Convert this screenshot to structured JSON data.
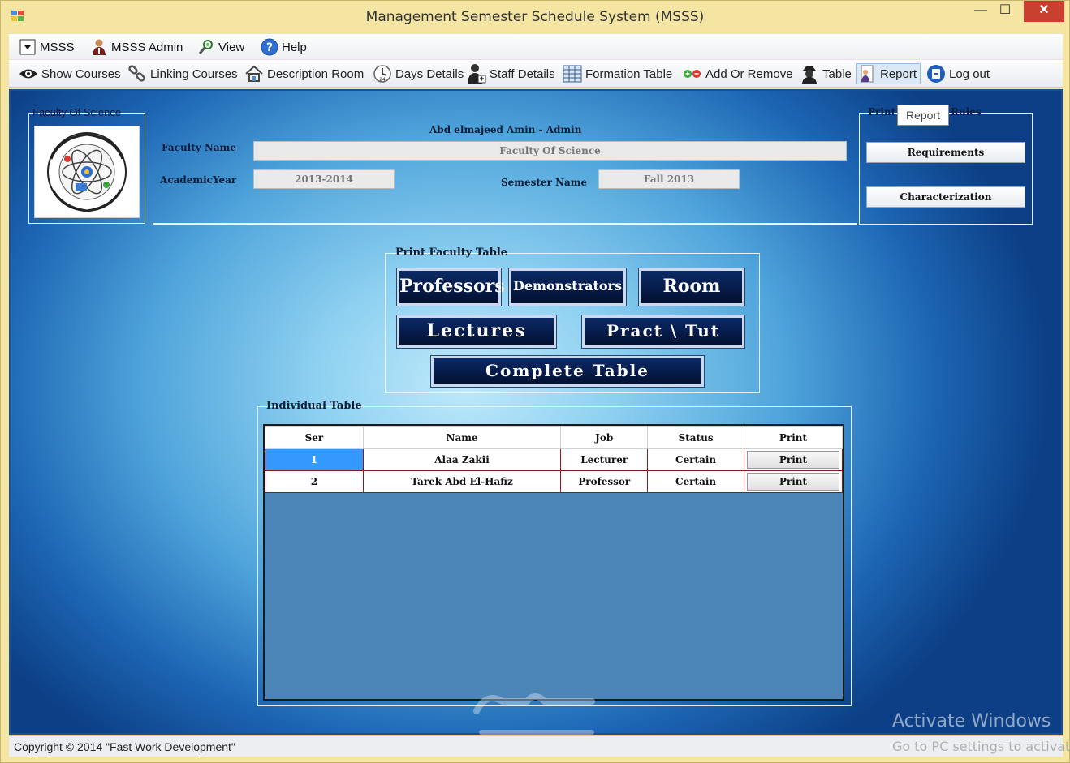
{
  "window": {
    "title": "Management Semester Schedule System (MSSS)",
    "min_glyph": "—",
    "max_glyph": "☐",
    "close_glyph": "✕"
  },
  "menu": {
    "items": [
      {
        "label": "MSSS",
        "icon": "dropdown-icon"
      },
      {
        "label": "MSSS Admin",
        "icon": "admin-user-icon"
      },
      {
        "label": "View",
        "icon": "view-search-icon"
      },
      {
        "label": "Help",
        "icon": "help-icon"
      }
    ]
  },
  "toolbar": {
    "items": [
      {
        "label": "Show Courses",
        "icon": "eye-icon"
      },
      {
        "label": "Linking Courses",
        "icon": "link-icon"
      },
      {
        "label": "Description Room",
        "icon": "home-icon"
      },
      {
        "label": "Days Details",
        "icon": "clock-icon"
      },
      {
        "label": "Staff Details",
        "icon": "staff-icon"
      },
      {
        "label": "Formation Table",
        "icon": "table-grid-icon"
      },
      {
        "label": "Add Or Remove",
        "icon": "add-remove-icon"
      },
      {
        "label": "Table",
        "icon": "spy-icon"
      },
      {
        "label": "Report",
        "icon": "report-icon"
      },
      {
        "label": "Log out",
        "icon": "logout-icon"
      }
    ]
  },
  "header": {
    "logo_group_title": "Faculty Of Science",
    "user_line": "Abd elmajeed Amin - Admin",
    "faculty_name_label": "Faculty Name",
    "faculty_name_value": "Faculty Of Science",
    "academic_year_label": "AcademicYear",
    "academic_year_value": "2013-2014",
    "semester_name_label": "Semester Name",
    "semester_name_value": "Fall 2013"
  },
  "rules": {
    "title_left": "Print",
    "title_right": "Rules",
    "tooltip": "Report",
    "requirements_label": "Requirements",
    "characterization_label": "Characterization"
  },
  "print_faculty": {
    "title": "Print Faculty Table",
    "professors": "Professors",
    "demonstrators": "Demonstrators",
    "room": "Room",
    "lectures": "Lectures",
    "pract_tut": "Pract \\ Tut",
    "complete_table": "Complete Table"
  },
  "individual": {
    "title": "Individual Table",
    "columns": [
      "Ser",
      "Name",
      "Job",
      "Status",
      "Print"
    ],
    "rows": [
      {
        "ser": "1",
        "name": "Alaa Zakii",
        "job": "Lecturer",
        "status": "Certain",
        "print": "Print"
      },
      {
        "ser": "2",
        "name": "Tarek Abd El-Hafiz",
        "job": "Professor",
        "status": "Certain",
        "print": "Print"
      }
    ]
  },
  "status": {
    "copyright": "Copyright © 2014 \"Fast Work Development\""
  },
  "overlay": {
    "activate_line1": "Activate Windows",
    "activate_line2": "Go to PC settings to activate"
  },
  "colors": {
    "accent_blue": "#1d66b4",
    "button_navy": "#061a47",
    "selected_cell": "#3399ff",
    "row_border": "#8c1b1b",
    "grid_background": "#4c85b8"
  }
}
